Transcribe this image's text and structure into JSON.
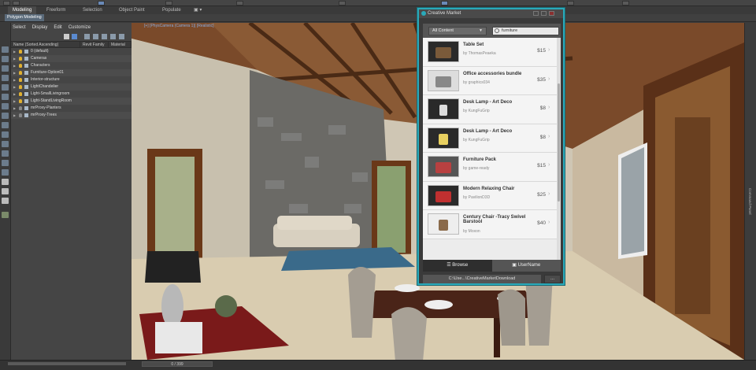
{
  "ribbon": {
    "tabs": [
      "Modeling",
      "Freeform",
      "Selection",
      "Object Paint",
      "Populate"
    ],
    "sub_tab": "Polygon Modeling"
  },
  "explorer": {
    "menu": [
      "Select",
      "Display",
      "Edit",
      "Customize"
    ],
    "columns": [
      "Name (Sorted Ascending)",
      "Revit Family",
      "Material"
    ],
    "rows": [
      "0 (default)",
      "Cameras",
      "Characters",
      "Furniture-Option01",
      "Interior-structure",
      "LightChandelier",
      "Light-SmallLivingroom",
      "Light-StandLivingRoom",
      "mrProxy-Planters",
      "mrProxy-Trees"
    ]
  },
  "viewport": {
    "label": "[+] [PhysCamera (Camera 1)] [Realistic]",
    "side_label": "Command Panel"
  },
  "status": {
    "time": "0 / 399"
  },
  "creative_market": {
    "title": "Creative Market",
    "filter": "All Content",
    "search": "furniture",
    "items": [
      {
        "name": "Table Set",
        "by": "by ThomasPeaeka",
        "price": "$15"
      },
      {
        "name": "Office accessories bundle",
        "by": "by graphics034",
        "price": "$35"
      },
      {
        "name": "Desk Lamp - Art Deco",
        "by": "by KungFuGrip",
        "price": "$8"
      },
      {
        "name": "Desk Lamp - Art Deco",
        "by": "by KungFuGrip",
        "price": "$8"
      },
      {
        "name": "Furniture Pack",
        "by": "by game-ready",
        "price": "$15"
      },
      {
        "name": "Modern Relaxing Chair",
        "by": "by PavilionD3D",
        "price": "$25"
      },
      {
        "name": "Century Chair -Tracy Swivel Barstool",
        "by": "by Moxon",
        "price": "$40"
      }
    ],
    "tabs": {
      "browse": "Browse",
      "user": "UserName"
    },
    "path": "C:\\Use...\\CreativeMarketDownload",
    "more": "..."
  }
}
